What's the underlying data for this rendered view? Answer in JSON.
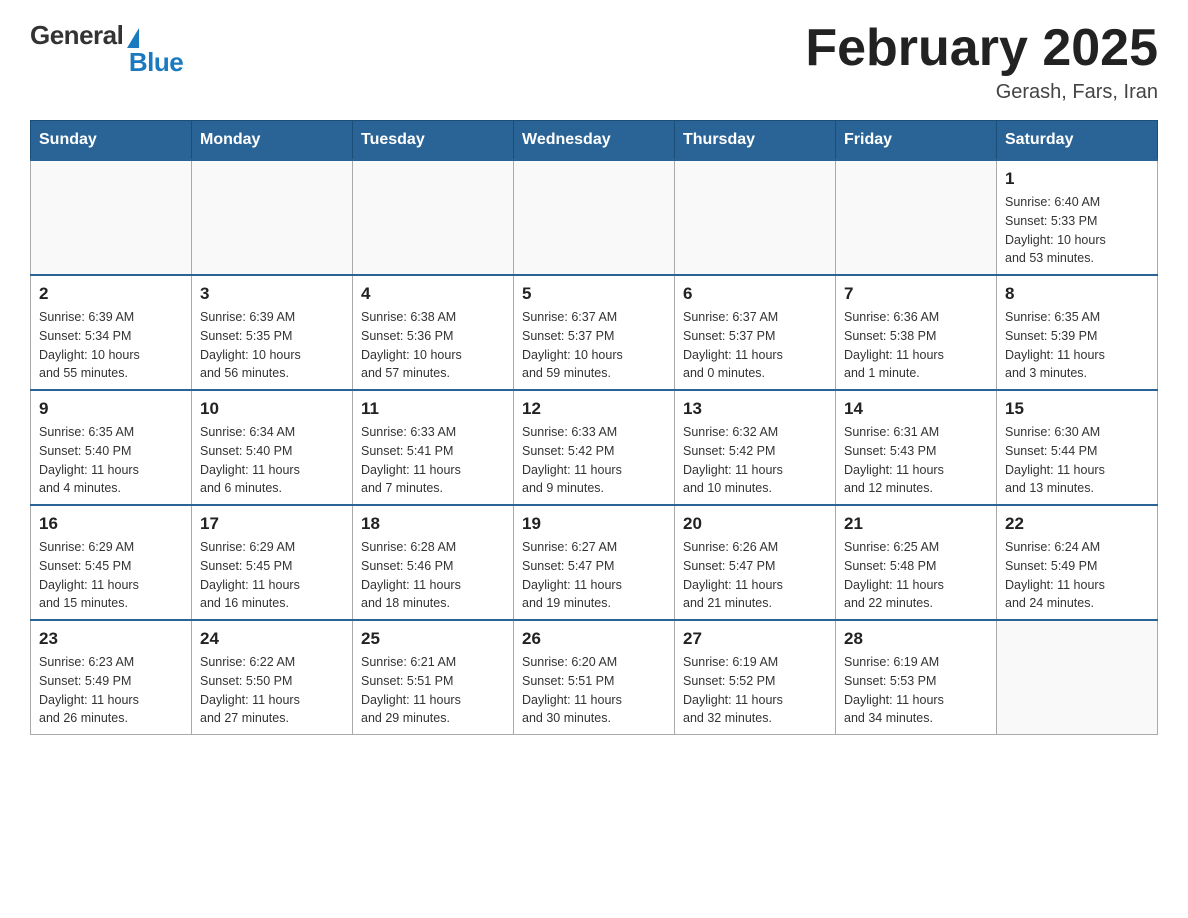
{
  "logo": {
    "general": "General",
    "blue": "Blue"
  },
  "title": "February 2025",
  "subtitle": "Gerash, Fars, Iran",
  "weekdays": [
    "Sunday",
    "Monday",
    "Tuesday",
    "Wednesday",
    "Thursday",
    "Friday",
    "Saturday"
  ],
  "weeks": [
    [
      {
        "day": "",
        "info": ""
      },
      {
        "day": "",
        "info": ""
      },
      {
        "day": "",
        "info": ""
      },
      {
        "day": "",
        "info": ""
      },
      {
        "day": "",
        "info": ""
      },
      {
        "day": "",
        "info": ""
      },
      {
        "day": "1",
        "info": "Sunrise: 6:40 AM\nSunset: 5:33 PM\nDaylight: 10 hours\nand 53 minutes."
      }
    ],
    [
      {
        "day": "2",
        "info": "Sunrise: 6:39 AM\nSunset: 5:34 PM\nDaylight: 10 hours\nand 55 minutes."
      },
      {
        "day": "3",
        "info": "Sunrise: 6:39 AM\nSunset: 5:35 PM\nDaylight: 10 hours\nand 56 minutes."
      },
      {
        "day": "4",
        "info": "Sunrise: 6:38 AM\nSunset: 5:36 PM\nDaylight: 10 hours\nand 57 minutes."
      },
      {
        "day": "5",
        "info": "Sunrise: 6:37 AM\nSunset: 5:37 PM\nDaylight: 10 hours\nand 59 minutes."
      },
      {
        "day": "6",
        "info": "Sunrise: 6:37 AM\nSunset: 5:37 PM\nDaylight: 11 hours\nand 0 minutes."
      },
      {
        "day": "7",
        "info": "Sunrise: 6:36 AM\nSunset: 5:38 PM\nDaylight: 11 hours\nand 1 minute."
      },
      {
        "day": "8",
        "info": "Sunrise: 6:35 AM\nSunset: 5:39 PM\nDaylight: 11 hours\nand 3 minutes."
      }
    ],
    [
      {
        "day": "9",
        "info": "Sunrise: 6:35 AM\nSunset: 5:40 PM\nDaylight: 11 hours\nand 4 minutes."
      },
      {
        "day": "10",
        "info": "Sunrise: 6:34 AM\nSunset: 5:40 PM\nDaylight: 11 hours\nand 6 minutes."
      },
      {
        "day": "11",
        "info": "Sunrise: 6:33 AM\nSunset: 5:41 PM\nDaylight: 11 hours\nand 7 minutes."
      },
      {
        "day": "12",
        "info": "Sunrise: 6:33 AM\nSunset: 5:42 PM\nDaylight: 11 hours\nand 9 minutes."
      },
      {
        "day": "13",
        "info": "Sunrise: 6:32 AM\nSunset: 5:42 PM\nDaylight: 11 hours\nand 10 minutes."
      },
      {
        "day": "14",
        "info": "Sunrise: 6:31 AM\nSunset: 5:43 PM\nDaylight: 11 hours\nand 12 minutes."
      },
      {
        "day": "15",
        "info": "Sunrise: 6:30 AM\nSunset: 5:44 PM\nDaylight: 11 hours\nand 13 minutes."
      }
    ],
    [
      {
        "day": "16",
        "info": "Sunrise: 6:29 AM\nSunset: 5:45 PM\nDaylight: 11 hours\nand 15 minutes."
      },
      {
        "day": "17",
        "info": "Sunrise: 6:29 AM\nSunset: 5:45 PM\nDaylight: 11 hours\nand 16 minutes."
      },
      {
        "day": "18",
        "info": "Sunrise: 6:28 AM\nSunset: 5:46 PM\nDaylight: 11 hours\nand 18 minutes."
      },
      {
        "day": "19",
        "info": "Sunrise: 6:27 AM\nSunset: 5:47 PM\nDaylight: 11 hours\nand 19 minutes."
      },
      {
        "day": "20",
        "info": "Sunrise: 6:26 AM\nSunset: 5:47 PM\nDaylight: 11 hours\nand 21 minutes."
      },
      {
        "day": "21",
        "info": "Sunrise: 6:25 AM\nSunset: 5:48 PM\nDaylight: 11 hours\nand 22 minutes."
      },
      {
        "day": "22",
        "info": "Sunrise: 6:24 AM\nSunset: 5:49 PM\nDaylight: 11 hours\nand 24 minutes."
      }
    ],
    [
      {
        "day": "23",
        "info": "Sunrise: 6:23 AM\nSunset: 5:49 PM\nDaylight: 11 hours\nand 26 minutes."
      },
      {
        "day": "24",
        "info": "Sunrise: 6:22 AM\nSunset: 5:50 PM\nDaylight: 11 hours\nand 27 minutes."
      },
      {
        "day": "25",
        "info": "Sunrise: 6:21 AM\nSunset: 5:51 PM\nDaylight: 11 hours\nand 29 minutes."
      },
      {
        "day": "26",
        "info": "Sunrise: 6:20 AM\nSunset: 5:51 PM\nDaylight: 11 hours\nand 30 minutes."
      },
      {
        "day": "27",
        "info": "Sunrise: 6:19 AM\nSunset: 5:52 PM\nDaylight: 11 hours\nand 32 minutes."
      },
      {
        "day": "28",
        "info": "Sunrise: 6:19 AM\nSunset: 5:53 PM\nDaylight: 11 hours\nand 34 minutes."
      },
      {
        "day": "",
        "info": ""
      }
    ]
  ]
}
